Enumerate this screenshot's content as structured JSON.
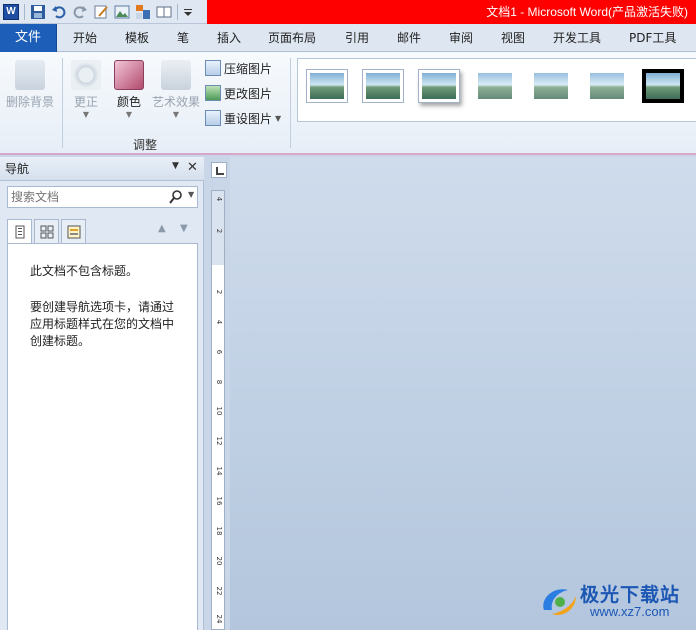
{
  "window": {
    "title": "文档1 - Microsoft Word(产品激活失败)"
  },
  "quick_access": {
    "icons": [
      "word-logo",
      "save-icon",
      "undo-icon",
      "redo-icon",
      "edit-icon",
      "picture-icon",
      "layout-icon",
      "book-icon",
      "customize-icon"
    ],
    "word_logo_text": "W"
  },
  "tabs": {
    "file": "文件",
    "items": [
      "开始",
      "模板",
      "笔",
      "插入",
      "页面布局",
      "引用",
      "邮件",
      "审阅",
      "视图",
      "开发工具",
      "PDF工具"
    ]
  },
  "ribbon": {
    "remove_bg": "删除背景",
    "corrections": "更正",
    "color": "颜色",
    "artistic": "艺术效果",
    "compress": "压缩图片",
    "change": "更改图片",
    "reset": "重设图片",
    "group_label": "调整",
    "picture_styles": 7
  },
  "nav": {
    "title": "导航",
    "search_placeholder": "搜索文档",
    "message_1": "此文档不包含标题。",
    "message_2": "要创建导航选项卡，请通过应用标题样式在您的文档中创建标题。"
  },
  "ruler": {
    "numbers": [
      "4",
      "2",
      "2",
      "4",
      "6",
      "8",
      "10",
      "12",
      "14",
      "16",
      "18",
      "20",
      "22",
      "24"
    ]
  },
  "watermark": {
    "name": "极光下载站",
    "url": "www.xz7.com"
  },
  "colors": {
    "file_tab": "#1d5fb8",
    "title_bar": "#ff0000",
    "doc_bg": "#c3d3e6"
  }
}
